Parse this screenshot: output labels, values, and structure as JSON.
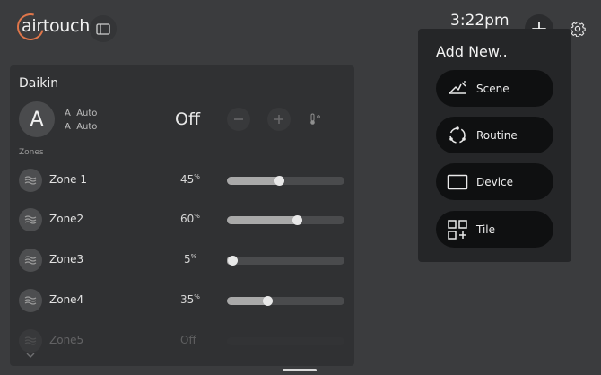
{
  "header": {
    "logo_text": "airtouch",
    "time": "3:22pm"
  },
  "ac_unit": {
    "name": "Daikin",
    "mode_letter": "A",
    "mode_line_1": "A  Auto",
    "mode_line_2": "A  Auto",
    "power_state": "Off",
    "zones_heading": "Zones",
    "zones": [
      {
        "name": "Zone 1",
        "percent_label": "45",
        "value": 45
      },
      {
        "name": "Zone2",
        "percent_label": "60",
        "value": 60
      },
      {
        "name": "Zone3",
        "percent_label": "5",
        "value": 5
      },
      {
        "name": "Zone4",
        "percent_label": "35",
        "value": 35
      },
      {
        "name": "Zone5",
        "percent_label": "Off",
        "value": 0
      }
    ],
    "percent_symbol": "%"
  },
  "add_menu": {
    "title": "Add New..",
    "items": [
      {
        "label": "Scene",
        "icon": "scene-icon"
      },
      {
        "label": "Routine",
        "icon": "routine-icon"
      },
      {
        "label": "Device",
        "icon": "device-icon"
      },
      {
        "label": "Tile",
        "icon": "tile-icon"
      }
    ]
  },
  "colors": {
    "background": "#3b3c3e",
    "panel": "#303133",
    "menu": "#252628",
    "menu_item": "#0f1011",
    "logo_accent": "#e0764a"
  }
}
